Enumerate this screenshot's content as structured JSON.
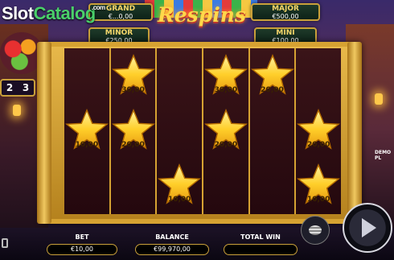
{
  "watermark": {
    "brand_a": "Slot",
    "brand_b": "Catalog",
    "suffix": ".com"
  },
  "logo": "Respins",
  "jackpots": {
    "grand": {
      "name": "GRAND",
      "value": "€...0,00"
    },
    "minor": {
      "name": "MINOR",
      "value": "€250,00"
    },
    "major": {
      "name": "MAJOR",
      "value": "€500,00"
    },
    "mini": {
      "name": "MINI",
      "value": "€100,00"
    }
  },
  "respin_counter": [
    "2",
    "3"
  ],
  "demo_label": "DEMO PL",
  "reels": [
    [
      {
        "row": 1,
        "value": "10,00"
      }
    ],
    [
      {
        "row": 0,
        "value": "30,00"
      },
      {
        "row": 1,
        "value": "20,00"
      }
    ],
    [
      {
        "row": 2,
        "value": "10,00"
      }
    ],
    [
      {
        "row": 0,
        "value": "30,00"
      },
      {
        "row": 1,
        "value": "20,00"
      }
    ],
    [
      {
        "row": 0,
        "value": "20,00"
      }
    ],
    [
      {
        "row": 1,
        "value": "20,00"
      },
      {
        "row": 2,
        "value": "10,00"
      }
    ]
  ],
  "bottom_bar": {
    "bet_label": "BET",
    "bet_value": "€10,00",
    "balance_label": "BALANCE",
    "balance_value": "€99,970,00",
    "total_win_label": "TOTAL WIN",
    "total_win_value": ""
  },
  "icons": [
    "coins-icon",
    "spin-icon",
    "sound-icon"
  ],
  "colors": {
    "gold": "#d6a232",
    "star": "#ffcf2a",
    "reel_bg": "#2a0c12"
  }
}
